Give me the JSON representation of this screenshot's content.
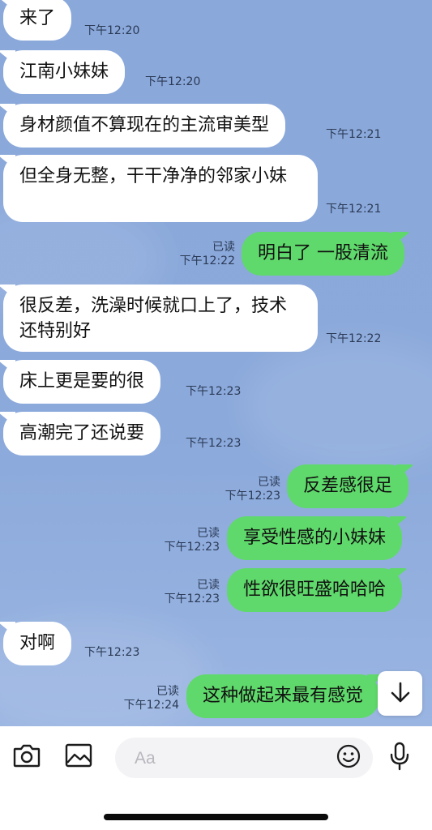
{
  "messages": [
    {
      "dir": "in",
      "text": "来了",
      "time": "下午12:20"
    },
    {
      "dir": "in",
      "text": "江南小妹妹",
      "time": "下午12:20"
    },
    {
      "dir": "in",
      "text": "身材颜值不算现在的主流审美型",
      "time": "下午12:21"
    },
    {
      "dir": "in",
      "text": "但全身无整，干干净净的邻家小妹",
      "time": "下午12:21"
    },
    {
      "dir": "out",
      "text": "明白了 一股清流",
      "read": "已读",
      "time": "下午12:22"
    },
    {
      "dir": "in",
      "text": "很反差，洗澡时候就口上了，技术还特别好",
      "time": "下午12:22"
    },
    {
      "dir": "in",
      "text": "床上更是要的很",
      "time": "下午12:23"
    },
    {
      "dir": "in",
      "text": "高潮完了还说要",
      "time": "下午12:23"
    },
    {
      "dir": "out",
      "text": "反差感很足",
      "read": "已读",
      "time": "下午12:23"
    },
    {
      "dir": "out",
      "text": "享受性感的小妹妹",
      "read": "已读",
      "time": "下午12:23"
    },
    {
      "dir": "out",
      "text": "性欲很旺盛哈哈哈",
      "read": "已读",
      "time": "下午12:23"
    },
    {
      "dir": "in",
      "text": "对啊",
      "time": "下午12:23"
    },
    {
      "dir": "out",
      "text": "这种做起来最有感觉",
      "read": "已读",
      "time": "下午12:24"
    }
  ],
  "composer": {
    "placeholder": "Aa",
    "value": ""
  },
  "icons": {
    "camera": "camera-icon",
    "gallery": "image-icon",
    "emoji": "emoji-icon",
    "mic": "microphone-icon",
    "scroll": "arrow-down-icon"
  },
  "colors": {
    "chat_background": "#8aa9da",
    "incoming_bubble": "#ffffff",
    "outgoing_bubble": "#5fd96b",
    "timestamp_text": "#2b3a55"
  }
}
